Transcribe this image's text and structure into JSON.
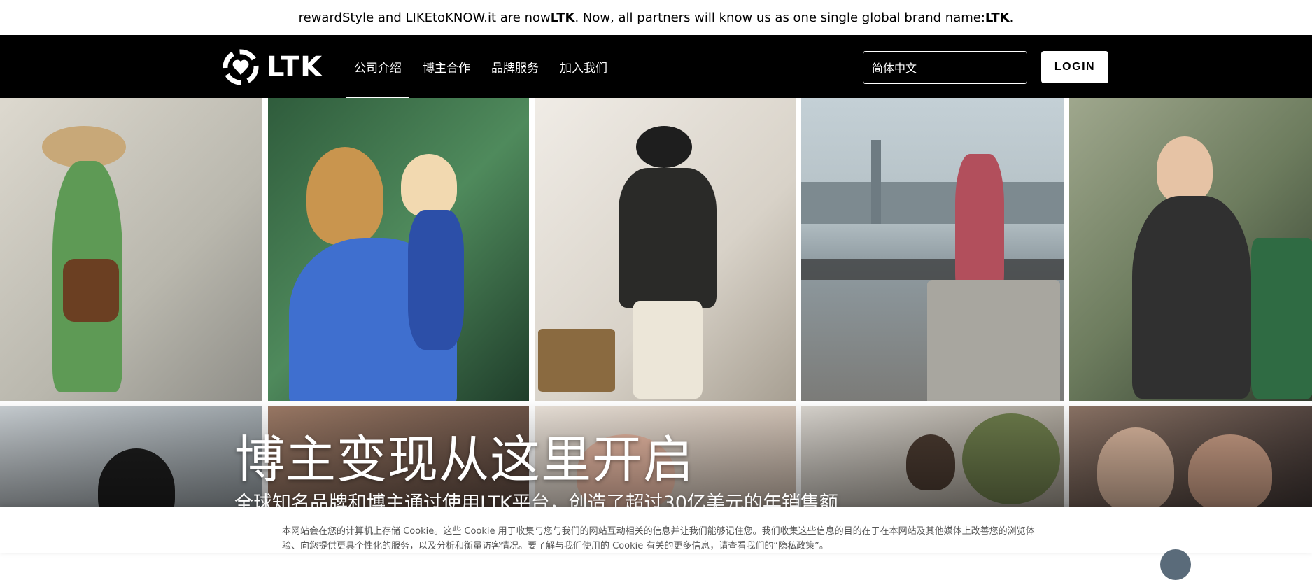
{
  "announcement": {
    "part1": "rewardStyle and LIKEtoKNOW.it are now ",
    "brand1": "LTK",
    "part2": ". Now, all partners will know us as one single global brand name: ",
    "brand2": "LTK",
    "part3": "."
  },
  "header": {
    "logo_text": "LTK",
    "nav": [
      {
        "label": "公司介绍",
        "active": true
      },
      {
        "label": "博主合作",
        "active": false
      },
      {
        "label": "品牌服务",
        "active": false
      },
      {
        "label": "加入我们",
        "active": false
      }
    ],
    "language_select": "简体中文",
    "login_label": "LOGIN"
  },
  "hero": {
    "title": "博主变现从这里开启",
    "subtitle": "全球知名品牌和博主通过使用LTK平台，创造了超过30亿美元的年销售额"
  },
  "cookie_banner": {
    "text": "本网站会在您的计算机上存储 Cookie。这些 Cookie 用于收集与您与我们的网站互动相关的信息并让我们能够记住您。我们收集这些信息的目的在于在本网站及其他媒体上改善您的浏览体验、向您提供更具个性化的服务，以及分析和衡量访客情况。要了解与我们使用的 Cookie 有关的更多信息，请查看我们的“隐私政策”。"
  },
  "colors": {
    "nav_bg": "#000000",
    "accent": "#ffffff"
  }
}
